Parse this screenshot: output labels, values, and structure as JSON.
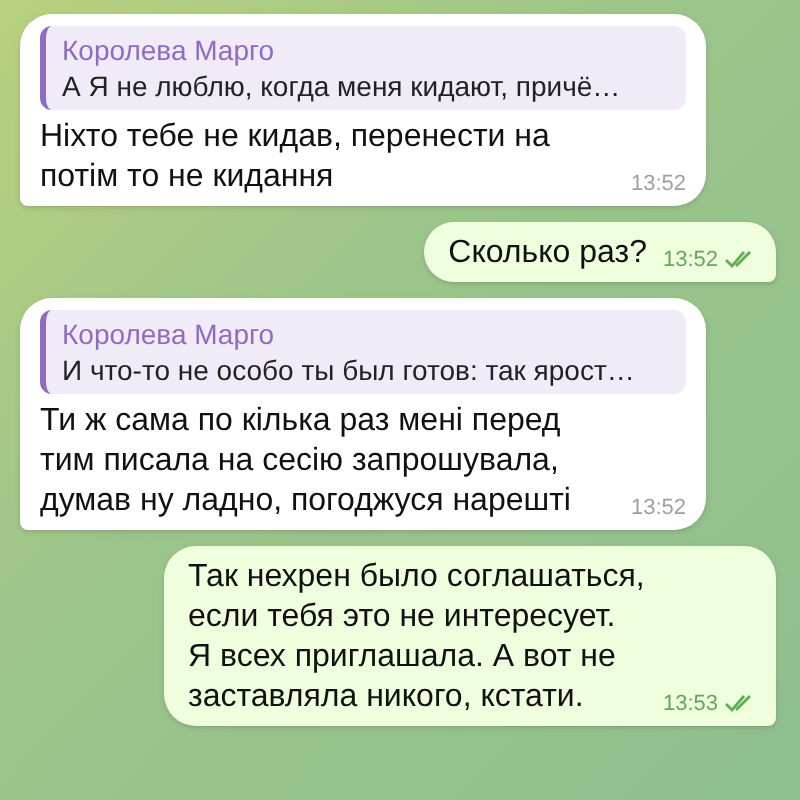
{
  "messages": [
    {
      "kind": "incoming",
      "reply": {
        "author": "Королева Марго",
        "text": "А Я не люблю, когда меня кидают, причё…"
      },
      "text": "Ніхто тебе не кидав, перенести на потім то не кидання",
      "time": "13:52"
    },
    {
      "kind": "outgoing",
      "text": "Сколько раз?",
      "time": "13:52",
      "read": true
    },
    {
      "kind": "incoming",
      "reply": {
        "author": "Королева Марго",
        "text": "И что-то не особо ты был готов: так ярост…"
      },
      "text": "Ти ж сама по кілька раз мені перед тим писала на сесію запрошувала, думав ну ладно, погоджуся нарешті",
      "time": "13:52"
    },
    {
      "kind": "outgoing",
      "text": "Так нехрен было соглашаться, если тебя это не интересует. Я всех приглашала. А вот не заставляла никого, кстати.",
      "time": "13:53",
      "read": true
    }
  ]
}
